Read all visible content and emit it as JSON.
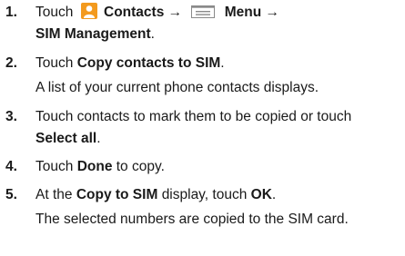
{
  "steps": [
    {
      "number": "1.",
      "touch": "Touch",
      "contacts_label": "Contacts",
      "arrow1": "→",
      "menu_label": "Menu",
      "arrow2": "→",
      "sim_management": "SIM Management",
      "period": "."
    },
    {
      "number": "2.",
      "touch": "Touch",
      "copy_contacts": "Copy contacts to SIM",
      "period": ".",
      "note": "A list of your current phone contacts displays."
    },
    {
      "number": "3.",
      "text_a": "Touch contacts to mark them to be copied or touch",
      "select_all": "Select all",
      "period": "."
    },
    {
      "number": "4.",
      "touch": "Touch",
      "done": "Done",
      "text_b": "to copy."
    },
    {
      "number": "5.",
      "at_the": "At the",
      "copy_to_sim": "Copy to SIM",
      "display_touch": "display, touch",
      "ok": "OK",
      "period": ".",
      "note": "The selected numbers are copied to the SIM card."
    }
  ],
  "icons": {
    "contacts": "contacts-app-icon",
    "menu": "menu-key-icon",
    "contacts_color": "#f39a1e",
    "menu_color": "#8a8a8a"
  }
}
